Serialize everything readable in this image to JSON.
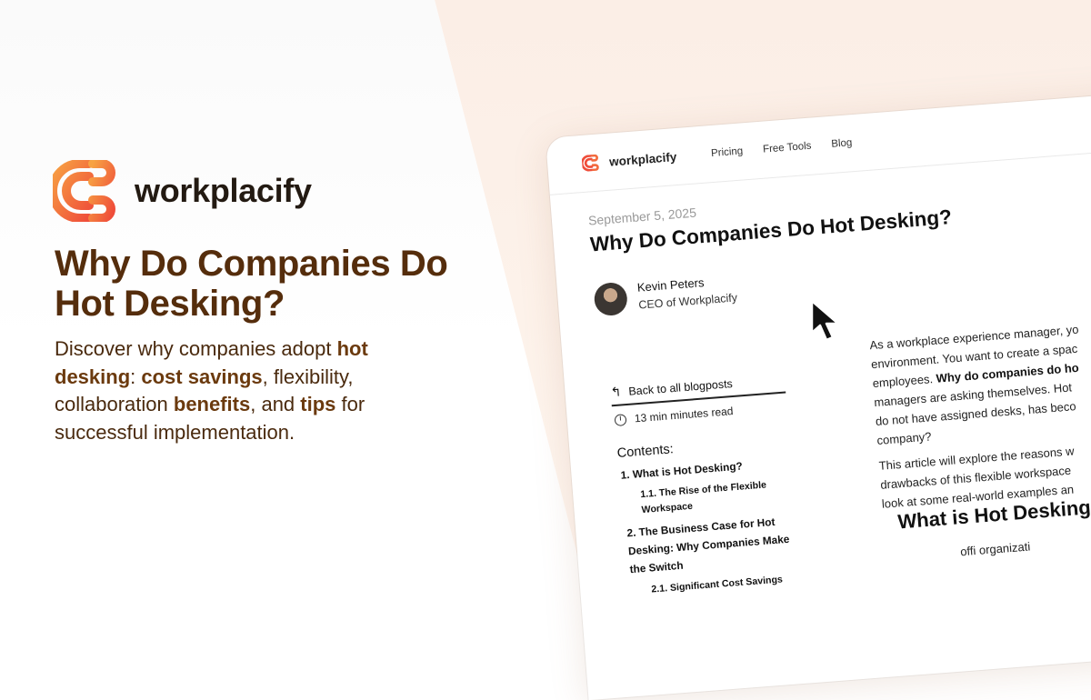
{
  "brand": {
    "name": "workplacify",
    "logo_colors": [
      "#ef4d3a",
      "#f7a343"
    ]
  },
  "headline": "Why Do Companies Do Hot Desking?",
  "description": {
    "parts": [
      {
        "text": "Discover why companies adopt ",
        "bold": false
      },
      {
        "text": "hot desking",
        "bold": true
      },
      {
        "text": ": ",
        "bold": false
      },
      {
        "text": "cost savings",
        "bold": true
      },
      {
        "text": ", flexibility, collaboration ",
        "bold": false
      },
      {
        "text": "benefits",
        "bold": true
      },
      {
        "text": ", and ",
        "bold": false
      },
      {
        "text": "tips",
        "bold": true
      },
      {
        "text": " for successful implementation.",
        "bold": false
      }
    ]
  },
  "mock": {
    "nav": {
      "brand": "workplacify",
      "links": [
        "Pricing",
        "Free Tools",
        "Blog"
      ]
    },
    "post": {
      "date": "September 5, 2025",
      "title": "Why Do Companies Do Hot Desking?",
      "author_name": "Kevin Peters",
      "author_role": "CEO of Workplacify"
    },
    "sidebar": {
      "back_label": "Back to all blogposts",
      "read_time": "13 min minutes read",
      "contents_label": "Contents:",
      "toc": [
        {
          "label": "1. What is Hot Desking?",
          "level": 1
        },
        {
          "label": "1.1. The Rise of the Flexible",
          "level": 2
        },
        {
          "label": "Workspace",
          "level": 2
        },
        {
          "label": "2. The Business Case for Hot",
          "level": 1
        },
        {
          "label": "Desking: Why Companies Make",
          "level": 1
        },
        {
          "label": "the Switch",
          "level": 1
        },
        {
          "label": "2.1. Significant Cost Savings",
          "level": 2
        }
      ]
    },
    "article": {
      "paragraph1": [
        {
          "text": "As a workplace experience manager, yo"
        },
        {
          "text": "environment. You want to create a spac"
        },
        {
          "text": "employees. ",
          "bold_tail": "Why do companies do ho"
        },
        {
          "text": "managers are asking themselves. Hot"
        },
        {
          "text": "do not have assigned desks, has beco"
        },
        {
          "text": "company?"
        }
      ],
      "paragraph2": [
        "This article will explore the reasons w",
        "drawbacks of this flexible workspace",
        "look at some real-world examples an"
      ],
      "heading": "What is Hot Desking?",
      "cut_line": "offi  organizati"
    }
  }
}
